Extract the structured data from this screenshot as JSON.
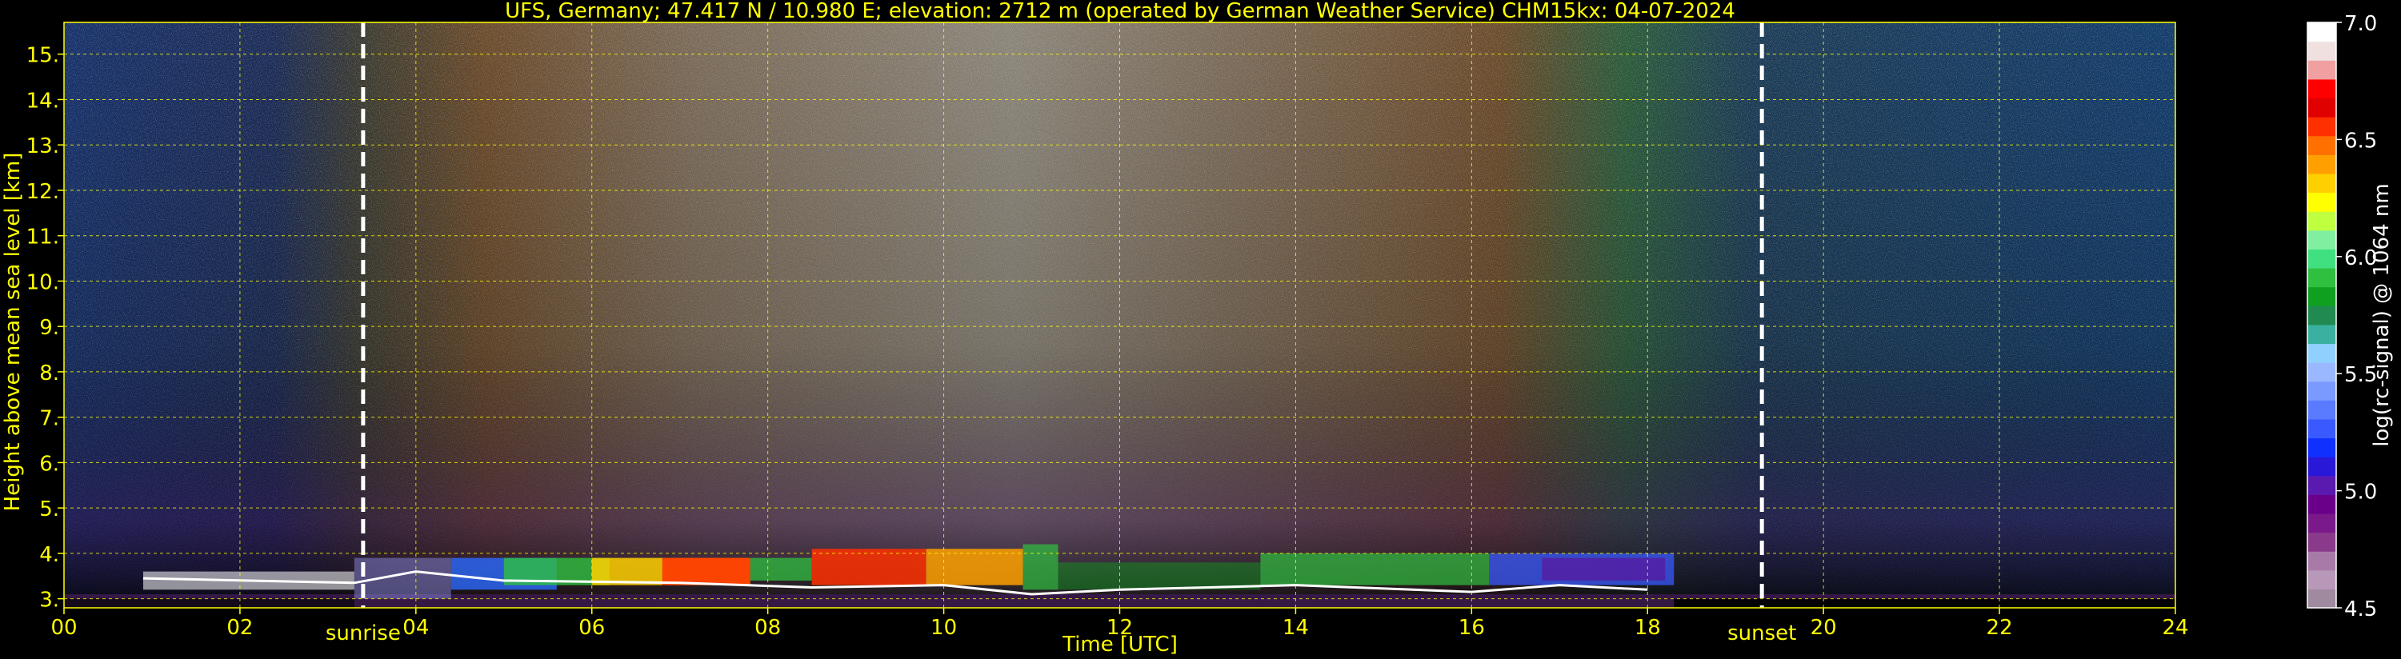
{
  "chart_data": {
    "type": "heatmap",
    "title": "UFS, Germany; 47.417 N / 10.980 E; elevation: 2712 m  (operated by German Weather Service)    CHM15kx: 04-07-2024",
    "xlabel": "Time [UTC]",
    "ylabel": "Height above mean sea level [km]",
    "xlim": [
      0,
      24
    ],
    "ylim": [
      2.8,
      15.7
    ],
    "x_ticks": [
      0,
      2,
      4,
      6,
      8,
      10,
      12,
      14,
      16,
      18,
      20,
      22,
      24
    ],
    "x_tick_labels": [
      "00",
      "02",
      "04",
      "06",
      "08",
      "10",
      "12",
      "14",
      "16",
      "18",
      "20",
      "22",
      "24"
    ],
    "y_ticks": [
      3,
      4,
      5,
      6,
      7,
      8,
      9,
      10,
      11,
      12,
      13,
      14,
      15
    ],
    "y_tick_labels": [
      "3.",
      "4.",
      "5.",
      "6.",
      "7.",
      "8.",
      "9.",
      "10.",
      "11.",
      "12.",
      "13.",
      "14.",
      "15."
    ],
    "grid": true,
    "annotations": [
      {
        "label": "sunrise",
        "x": 3.4
      },
      {
        "label": "sunset",
        "x": 19.3
      }
    ],
    "colorbar": {
      "label": "log(rc-signal) @ 1064 nm",
      "range": [
        4.5,
        7.0
      ],
      "ticks": [
        4.5,
        5.0,
        5.5,
        6.0,
        6.5,
        7.0
      ],
      "tick_labels": [
        "4.5",
        "5.0",
        "5.5",
        "6.0",
        "6.5",
        "7.0"
      ],
      "colors": [
        "#a08aa0",
        "#b898b8",
        "#a87aa8",
        "#8a3a8a",
        "#7a1a8a",
        "#6a008a",
        "#5a1ab0",
        "#2a18d8",
        "#1030ff",
        "#3a5aff",
        "#5a7aff",
        "#7a9aff",
        "#9ab8ff",
        "#8fd0ff",
        "#3ab0a0",
        "#208a50",
        "#10a020",
        "#30c040",
        "#40e080",
        "#80f0a0",
        "#c0ff40",
        "#ffff00",
        "#ffd000",
        "#ffa000",
        "#ff7000",
        "#ff3000",
        "#e00000",
        "#ff0000",
        "#f0a0a0",
        "#f0e0e0",
        "#ffffff"
      ]
    }
  }
}
